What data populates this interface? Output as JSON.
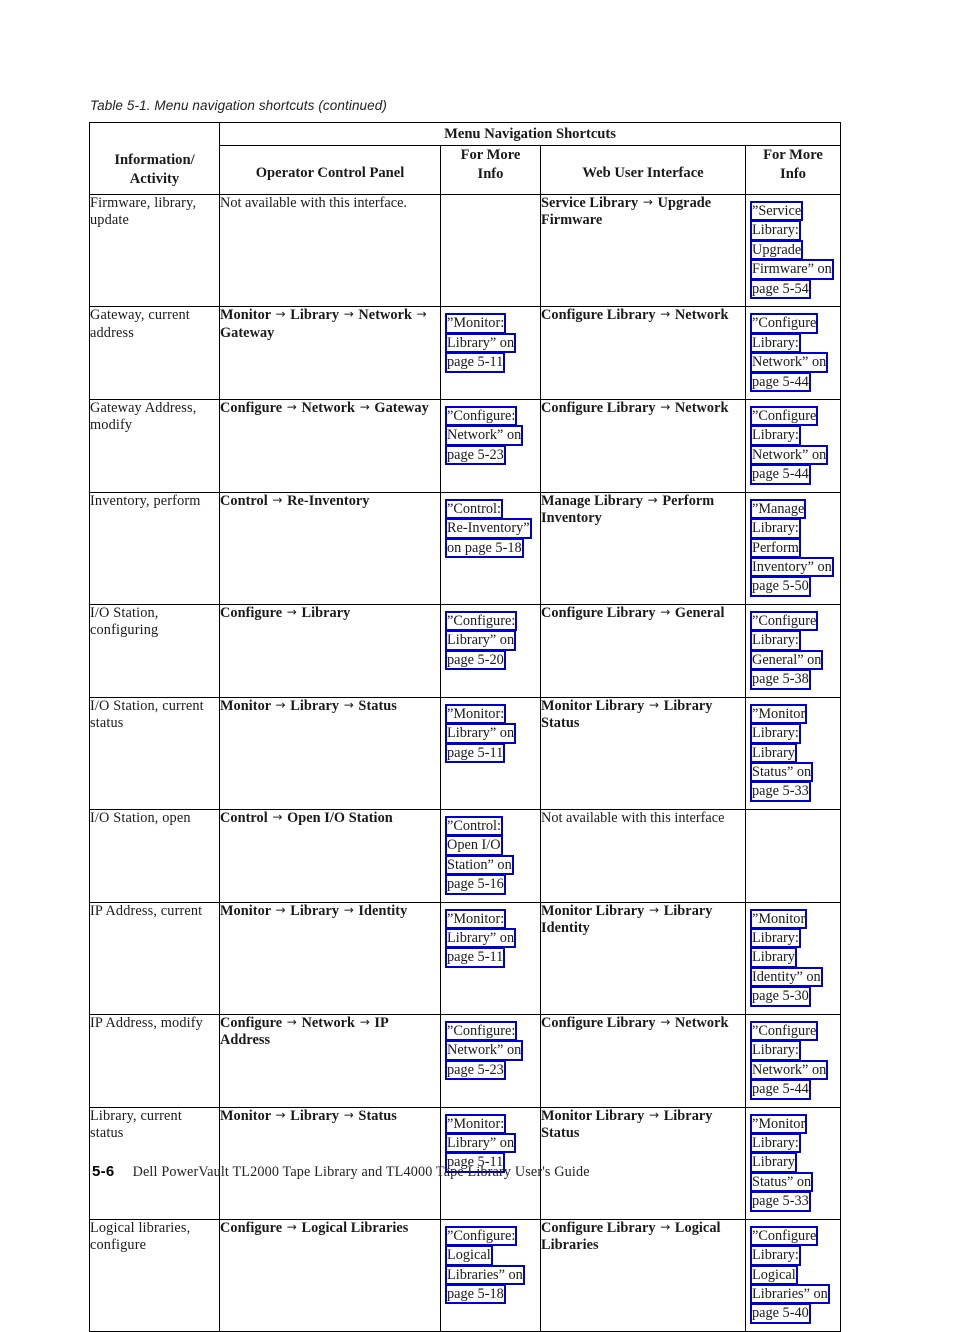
{
  "caption": "Table 5-1. Menu navigation shortcuts  (continued)",
  "table": {
    "group_header": "Menu Navigation Shortcuts",
    "columns": {
      "activity_line1": "Information/",
      "activity_line2": "Activity",
      "ocp": "Operator Control Panel",
      "info1_line1": "For More",
      "info1_line2": "Info",
      "web": "Web User Interface",
      "info2_line1": "For More",
      "info2_line2": "Info"
    },
    "rows": [
      {
        "activity": "Firmware, library, update",
        "ocp": "Not available with this interface.",
        "ocp_bold": false,
        "info1": [],
        "web": "Service Library → Upgrade Firmware",
        "web_bold": true,
        "info2": [
          "”Service",
          "Library:",
          "Upgrade",
          "Firmware” on",
          "page 5-54"
        ]
      },
      {
        "activity": "Gateway, current address",
        "ocp": "Monitor → Library → Network → Gateway",
        "ocp_bold": true,
        "info1": [
          "”Monitor:",
          "Library” on",
          "page 5-11"
        ],
        "web": "Configure Library → Network",
        "web_bold": true,
        "info2": [
          "”Configure",
          "Library:",
          "Network” on",
          "page 5-44"
        ]
      },
      {
        "activity": "Gateway Address, modify",
        "ocp": "Configure → Network → Gateway",
        "ocp_bold": true,
        "info1": [
          "”Configure:",
          "Network” on",
          "page 5-23"
        ],
        "web": "Configure Library → Network",
        "web_bold": true,
        "info2": [
          "”Configure",
          "Library:",
          "Network” on",
          "page 5-44"
        ]
      },
      {
        "activity": "Inventory, perform",
        "ocp": "Control → Re-Inventory",
        "ocp_bold": true,
        "info1": [
          "”Control:",
          "Re-Inventory”",
          "on page 5-18"
        ],
        "web": "Manage Library → Perform Inventory",
        "web_bold": true,
        "info2": [
          "”Manage",
          "Library:",
          "Perform",
          "Inventory” on",
          "page 5-50"
        ]
      },
      {
        "activity": "I/O Station, configuring",
        "ocp": "Configure → Library",
        "ocp_bold": true,
        "info1": [
          "”Configure:",
          "Library” on",
          "page 5-20"
        ],
        "web": "Configure Library → General",
        "web_bold": true,
        "info2": [
          "”Configure",
          "Library:",
          "General” on",
          "page 5-38"
        ]
      },
      {
        "activity": "I/O Station, current status",
        "ocp": "Monitor → Library → Status",
        "ocp_bold": true,
        "info1": [
          "”Monitor:",
          "Library” on",
          "page 5-11"
        ],
        "web": "Monitor Library → Library Status",
        "web_bold": true,
        "info2": [
          "”Monitor",
          "Library:",
          "Library",
          "Status” on",
          "page 5-33"
        ]
      },
      {
        "activity": "I/O Station, open",
        "ocp": "Control → Open I/O Station",
        "ocp_bold": true,
        "info1": [
          "”Control:",
          "Open I/O",
          "Station” on",
          "page 5-16"
        ],
        "web": "Not available with this interface",
        "web_bold": false,
        "info2": []
      },
      {
        "activity": "IP Address, current",
        "ocp": "Monitor → Library → Identity",
        "ocp_bold": true,
        "info1": [
          "”Monitor:",
          "Library” on",
          "page 5-11"
        ],
        "web": "Monitor Library → Library Identity",
        "web_bold": true,
        "info2": [
          "”Monitor",
          "Library:",
          "Library",
          "Identity” on",
          "page 5-30"
        ]
      },
      {
        "activity": "IP Address, modify",
        "ocp": "Configure → Network → IP Address",
        "ocp_bold": true,
        "info1": [
          "”Configure:",
          "Network” on",
          "page 5-23"
        ],
        "web": "Configure Library → Network",
        "web_bold": true,
        "info2": [
          "”Configure",
          "Library:",
          "Network” on",
          "page 5-44"
        ]
      },
      {
        "activity": "Library, current status",
        "ocp": "Monitor → Library → Status",
        "ocp_bold": true,
        "info1": [
          "”Monitor:",
          "Library” on",
          "page 5-11"
        ],
        "web": "Monitor Library → Library Status",
        "web_bold": true,
        "info2": [
          "”Monitor",
          "Library:",
          "Library",
          "Status” on",
          "page 5-33"
        ]
      },
      {
        "activity": "Logical libraries, configure",
        "ocp": "Configure → Logical Libraries",
        "ocp_bold": true,
        "info1": [
          "”Configure:",
          "Logical",
          "Libraries” on",
          "page 5-18"
        ],
        "web": "Configure Library → Logical Libraries",
        "web_bold": true,
        "info2": [
          "”Configure",
          "Library:",
          "Logical",
          "Libraries” on",
          "page 5-40"
        ]
      }
    ]
  },
  "footer": {
    "page_number": "5-6",
    "text": "Dell PowerVault TL2000 Tape Library and TL4000 Tape Library User's Guide"
  },
  "colors": {
    "link_border": "#0000cc",
    "text": "#1a1a1a",
    "rule": "#000000"
  }
}
